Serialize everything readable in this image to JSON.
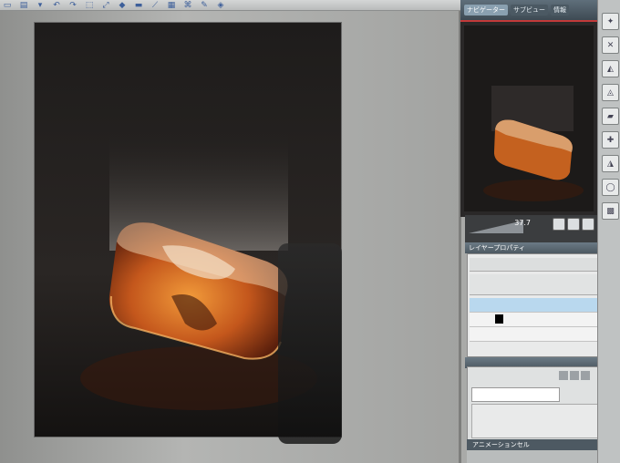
{
  "toolbar": {
    "icons": [
      "new-file-icon",
      "open-file-icon",
      "dropdown-icon",
      "undo-icon",
      "redo-icon",
      "select-icon",
      "transform-icon",
      "fill-icon",
      "eraser-icon",
      "ruler-icon",
      "grid-icon",
      "link-icon",
      "pen-icon",
      "settings-icon"
    ]
  },
  "panel_tabs": {
    "navigator": "ナビゲーター",
    "subview": "サブビュー",
    "info": "情報"
  },
  "navigator": {
    "zoom": "37.7"
  },
  "layer_property": {
    "header": "レイヤープロパティ"
  },
  "animation": {
    "header": "アニメーションセル"
  },
  "colors": {
    "accent_red": "#c23a3a",
    "panel_header": "#4d5962",
    "selected_layer": "#b9d8ee"
  }
}
